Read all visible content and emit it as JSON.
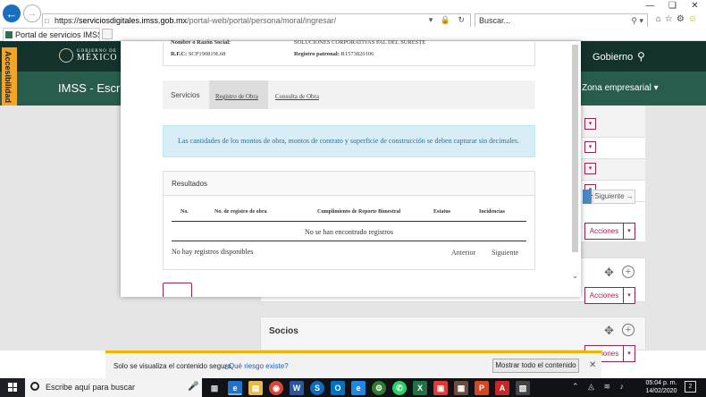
{
  "browser": {
    "url_scheme": "https://",
    "url_domain": "serviciosdigitales.imss.gob.mx",
    "url_path": "/portal-web/portal/persona/moral/ingresar/",
    "search_placeholder": "Buscar...",
    "tab_title": "Portal de servicios IMSS dig..."
  },
  "header": {
    "gov_small": "GOBIERNO DE",
    "gov_big": "MÉXICO",
    "gov_right": "Gobierno",
    "imss_title": "IMSS - Escrito",
    "imss_right": "Zona empresarial",
    "accessibility": "Accesibilidad"
  },
  "modal": {
    "info": {
      "razon_social_label": "Nombre o Razón Social:",
      "razon_social_value": "SOLUCIONES CORPORATIVAS PAL DEL SURESTE",
      "rfc_label": "R.F.C:",
      "rfc_value": "SCP190819L68",
      "registro_label": "Registro patronal:",
      "registro_value": "R1573820106"
    },
    "tabs": {
      "label": "Servicios",
      "active": "Registro de Obra",
      "other": "Consulta de Obra"
    },
    "alert": "Las cantidades de los montos de obra, montos de contrato y superficie de construcción se deben capturar sin decimales.",
    "results": {
      "title": "Resultados",
      "columns": [
        "No.",
        "No. de registro de obra",
        "Cumplimiento de Reporte Bimestral",
        "Estatus",
        "Incidencias"
      ],
      "empty_message": "No se han encontrado registros",
      "footer": "No hay registros disponibles",
      "prev": "Anterior",
      "next": "Siguiente"
    }
  },
  "background": {
    "siguiente": "Siguiente →",
    "acciones": "Acciones",
    "socios_title": "Socios"
  },
  "security_bar": {
    "text": "Solo se visualiza el contenido seguro.",
    "link": "¿Qué riesgo existe?",
    "button": "Mostrar todo el contenido"
  },
  "taskbar": {
    "search_text": "Escribe aquí para buscar",
    "time": "05:04 p. m.",
    "date": "14/02/2020",
    "notifications": "2"
  },
  "colors": {
    "gov_green": "#13322b",
    "imss_green": "#285c4d",
    "accent_red": "#9d2449",
    "alert_bg": "#d9edf7",
    "alert_text": "#31708f"
  }
}
